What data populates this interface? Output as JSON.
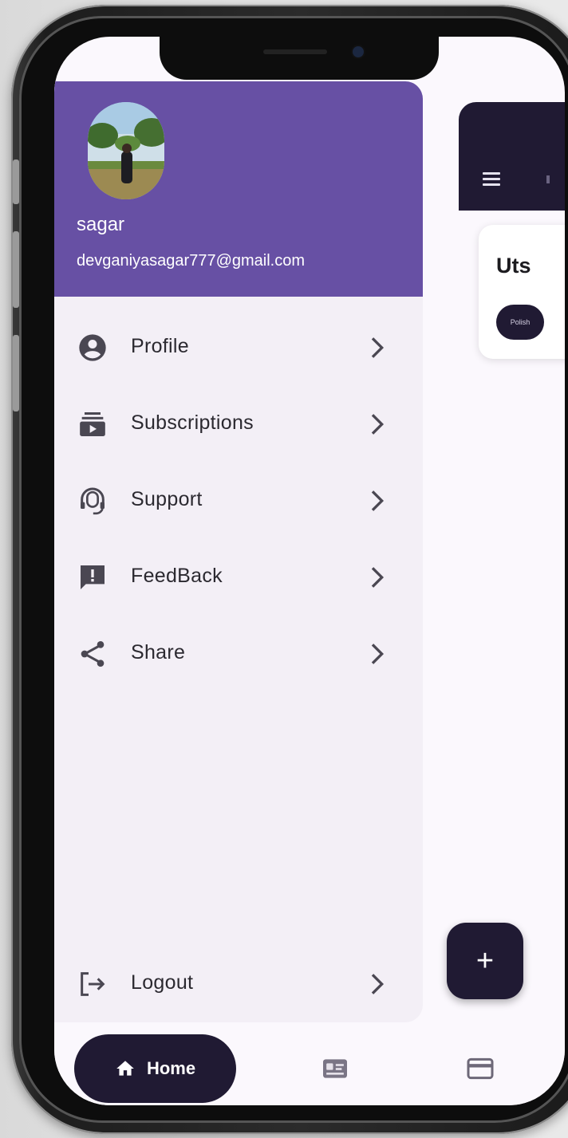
{
  "user": {
    "name": "sagar",
    "email": "devganiyasagar777@gmail.com"
  },
  "drawer": {
    "items": [
      {
        "label": "Profile",
        "icon": "account-circle-icon"
      },
      {
        "label": "Subscriptions",
        "icon": "subscriptions-icon"
      },
      {
        "label": "Support",
        "icon": "support-agent-icon"
      },
      {
        "label": "FeedBack",
        "icon": "feedback-icon"
      },
      {
        "label": "Share",
        "icon": "share-icon"
      }
    ],
    "logout": {
      "label": "Logout",
      "icon": "logout-icon"
    }
  },
  "background": {
    "card_title": "Uts",
    "card_chip": "Polish"
  },
  "fab": {
    "label": "+"
  },
  "bottom_nav": {
    "home_label": "Home",
    "items": [
      "home-icon",
      "id-card-icon",
      "payment-card-icon"
    ]
  },
  "colors": {
    "drawer_header": "#6750a4",
    "drawer_bg": "#f3eff6",
    "dark_accent": "#201a33"
  }
}
